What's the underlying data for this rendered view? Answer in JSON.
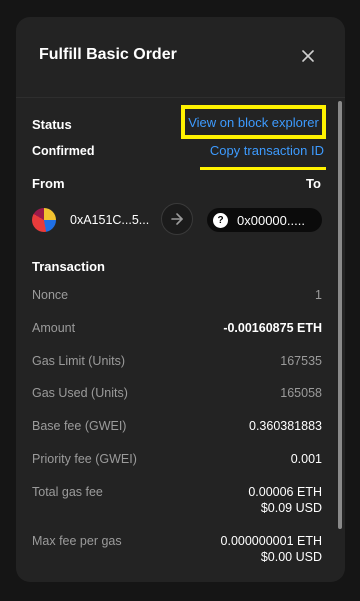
{
  "header": {
    "title": "Fulfill Basic Order",
    "close_icon": "close-icon"
  },
  "status": {
    "label": "Status",
    "value": "Confirmed",
    "explorer_link": "View on block explorer",
    "copy_link": "Copy transaction ID"
  },
  "parties": {
    "from_label": "From",
    "to_label": "To",
    "from_address": "0xA151C...5...",
    "to_address": "0x00000....."
  },
  "transaction": {
    "heading": "Transaction",
    "rows": [
      {
        "label": "Nonce",
        "value": "1"
      },
      {
        "label": "Amount",
        "value": "-0.00160875 ETH"
      },
      {
        "label": "Gas Limit (Units)",
        "value": "167535"
      },
      {
        "label": "Gas Used (Units)",
        "value": "165058"
      },
      {
        "label": "Base fee (GWEI)",
        "value": "0.360381883"
      },
      {
        "label": "Priority fee (GWEI)",
        "value": "0.001"
      },
      {
        "label": "Total gas fee",
        "value": "0.00006 ETH",
        "value2": "$0.09 USD"
      },
      {
        "label": "Max fee per gas",
        "value": "0.000000001 ETH",
        "value2": "$0.00 USD"
      }
    ]
  },
  "colors": {
    "link": "#3d9bff",
    "highlight": "#fff200",
    "panel": "#232323",
    "background": "#151515"
  }
}
